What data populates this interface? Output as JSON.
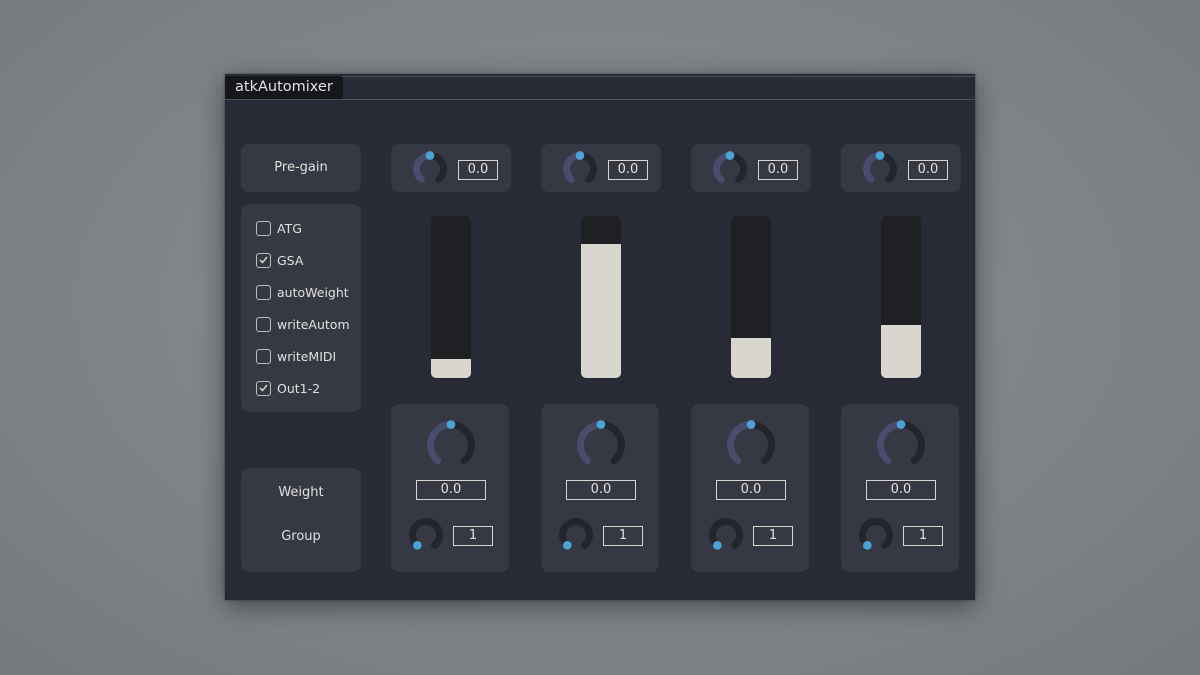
{
  "window": {
    "title": "atkAutomixer"
  },
  "left": {
    "pregain_label": "Pre-gain",
    "options": [
      {
        "label": "ATG",
        "checked": false
      },
      {
        "label": "GSA",
        "checked": true
      },
      {
        "label": "autoWeight",
        "checked": false
      },
      {
        "label": "writeAutom",
        "checked": false
      },
      {
        "label": "writeMIDI",
        "checked": false
      },
      {
        "label": "Out1-2",
        "checked": true
      }
    ],
    "weight_label": "Weight",
    "group_label": "Group"
  },
  "channels": [
    {
      "pregain": "0.0",
      "pregain_pos": 0.5,
      "meter_level": 0.12,
      "weight": "0.0",
      "weight_pos": 0.5,
      "group": "1",
      "group_pos": 0.0
    },
    {
      "pregain": "0.0",
      "pregain_pos": 0.5,
      "meter_level": 0.83,
      "weight": "0.0",
      "weight_pos": 0.5,
      "group": "1",
      "group_pos": 0.0
    },
    {
      "pregain": "0.0",
      "pregain_pos": 0.5,
      "meter_level": 0.25,
      "weight": "0.0",
      "weight_pos": 0.5,
      "group": "1",
      "group_pos": 0.0
    },
    {
      "pregain": "0.0",
      "pregain_pos": 0.5,
      "meter_level": 0.33,
      "weight": "0.0",
      "weight_pos": 0.5,
      "group": "1",
      "group_pos": 0.0
    }
  ],
  "colors": {
    "knob_track": "#23252d",
    "knob_value": "#4a4c6e",
    "knob_dot": "#4ba3d3",
    "meter_fill": "#d8d6cf"
  }
}
